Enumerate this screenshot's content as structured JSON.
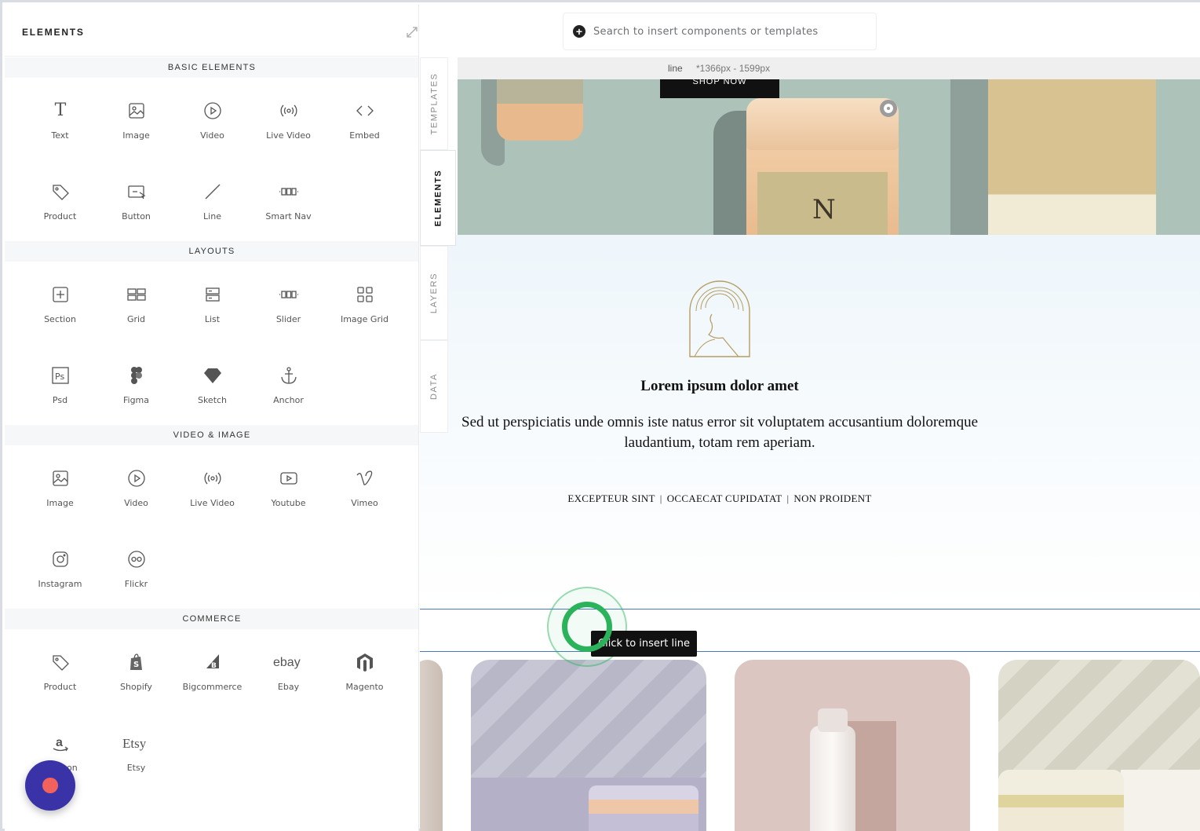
{
  "search": {
    "placeholder": "Search to insert components or templates"
  },
  "infobar": {
    "element": "line",
    "size": "*1366px - 1599px"
  },
  "hero": {
    "button_label": "SHOP NOW",
    "jar_letter": "N"
  },
  "content": {
    "heading": "Lorem ipsum dolor amet",
    "paragraph": "Sed ut perspiciatis unde omnis iste natus error sit voluptatem accusantium doloremque laudantium, totam rem aperiam.",
    "links": [
      "EXCEPTEUR SINT",
      "OCCAECAT CUPIDATAT",
      "NON PROIDENT"
    ]
  },
  "insert_tooltip": "Click to insert line",
  "tabs": [
    "TEMPLATES",
    "ELEMENTS",
    "LAYERS",
    "DATA"
  ],
  "panel": {
    "title": "ELEMENTS",
    "sections": [
      {
        "title": "BASIC ELEMENTS",
        "items": [
          {
            "label": "Text",
            "icon": "text-icon"
          },
          {
            "label": "Image",
            "icon": "image-icon"
          },
          {
            "label": "Video",
            "icon": "video-icon"
          },
          {
            "label": "Live Video",
            "icon": "live-video-icon"
          },
          {
            "label": "Embed",
            "icon": "embed-icon"
          },
          {
            "label": "Product",
            "icon": "tag-icon"
          },
          {
            "label": "Button",
            "icon": "button-icon"
          },
          {
            "label": "Line",
            "icon": "line-icon"
          },
          {
            "label": "Smart Nav",
            "icon": "smart-nav-icon"
          }
        ]
      },
      {
        "title": "LAYOUTS",
        "items": [
          {
            "label": "Section",
            "icon": "section-icon"
          },
          {
            "label": "Grid",
            "icon": "grid-icon"
          },
          {
            "label": "List",
            "icon": "list-icon"
          },
          {
            "label": "Slider",
            "icon": "slider-icon"
          },
          {
            "label": "Image Grid",
            "icon": "image-grid-icon"
          },
          {
            "label": "Psd",
            "icon": "psd-icon"
          },
          {
            "label": "Figma",
            "icon": "figma-icon"
          },
          {
            "label": "Sketch",
            "icon": "sketch-icon"
          },
          {
            "label": "Anchor",
            "icon": "anchor-icon"
          }
        ]
      },
      {
        "title": "VIDEO & IMAGE",
        "items": [
          {
            "label": "Image",
            "icon": "image-icon"
          },
          {
            "label": "Video",
            "icon": "video-icon"
          },
          {
            "label": "Live Video",
            "icon": "live-video-icon"
          },
          {
            "label": "Youtube",
            "icon": "youtube-icon"
          },
          {
            "label": "Vimeo",
            "icon": "vimeo-icon"
          },
          {
            "label": "Instagram",
            "icon": "instagram-icon"
          },
          {
            "label": "Flickr",
            "icon": "flickr-icon"
          }
        ]
      },
      {
        "title": "COMMERCE",
        "items": [
          {
            "label": "Product",
            "icon": "tag-icon"
          },
          {
            "label": "Shopify",
            "icon": "shopify-icon"
          },
          {
            "label": "Bigcommerce",
            "icon": "bigcommerce-icon"
          },
          {
            "label": "Ebay",
            "icon": "ebay-icon"
          },
          {
            "label": "Magento",
            "icon": "magento-icon"
          },
          {
            "label": "Amazon",
            "icon": "amazon-icon"
          },
          {
            "label": "Etsy",
            "icon": "etsy-icon"
          }
        ]
      }
    ]
  },
  "colors": {
    "accent_green": "#2bb35c",
    "chat_button": "#3a33a8",
    "chat_dot": "#f0625b"
  }
}
